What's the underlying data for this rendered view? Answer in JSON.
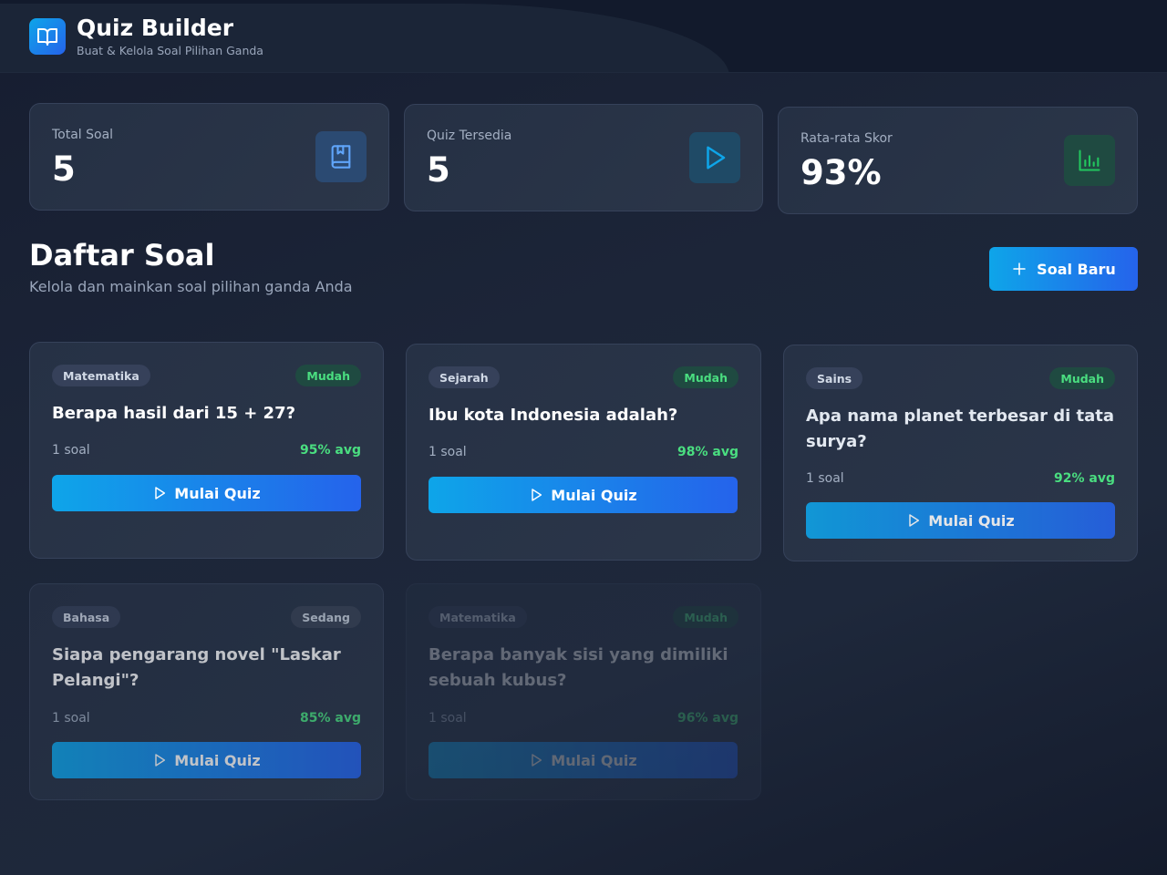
{
  "header": {
    "title": "Quiz Builder",
    "subtitle": "Buat & Kelola Soal Pilihan Ganda",
    "logo_icon": "open-book-icon"
  },
  "stats": [
    {
      "label": "Total Soal",
      "value": "5",
      "icon": "bookmark-book-icon",
      "color": "#3b82f6"
    },
    {
      "label": "Quiz Tersedia",
      "value": "5",
      "icon": "play-icon",
      "color": "#0ea5e9"
    },
    {
      "label": "Rata-rata Skor",
      "value": "93%",
      "icon": "bar-chart-icon",
      "color": "#22c55e"
    }
  ],
  "section": {
    "title": "Daftar Soal",
    "subtitle": "Kelola dan mainkan soal pilihan ganda Anda",
    "new_button": "Soal Baru"
  },
  "questions": [
    {
      "category": "Matematika",
      "difficulty": "Mudah",
      "question": "Berapa hasil dari 15 + 27?",
      "count": "1 soal",
      "avg": "95% avg",
      "button": "Mulai Quiz"
    },
    {
      "category": "Sejarah",
      "difficulty": "Mudah",
      "question": "Ibu kota Indonesia adalah?",
      "count": "1 soal",
      "avg": "98% avg",
      "button": "Mulai Quiz"
    },
    {
      "category": "Sains",
      "difficulty": "Mudah",
      "question": "Apa nama planet terbesar di tata surya?",
      "count": "1 soal",
      "avg": "92% avg",
      "button": "Mulai Quiz"
    },
    {
      "category": "Bahasa",
      "difficulty": "Sedang",
      "question": "Siapa pengarang novel \"Laskar Pelangi\"?",
      "count": "1 soal",
      "avg": "85% avg",
      "button": "Mulai Quiz"
    },
    {
      "category": "Matematika",
      "difficulty": "Mudah",
      "question": "Berapa banyak sisi yang dimiliki sebuah kubus?",
      "count": "1 soal",
      "avg": "96% avg",
      "button": "Mulai Quiz"
    }
  ]
}
